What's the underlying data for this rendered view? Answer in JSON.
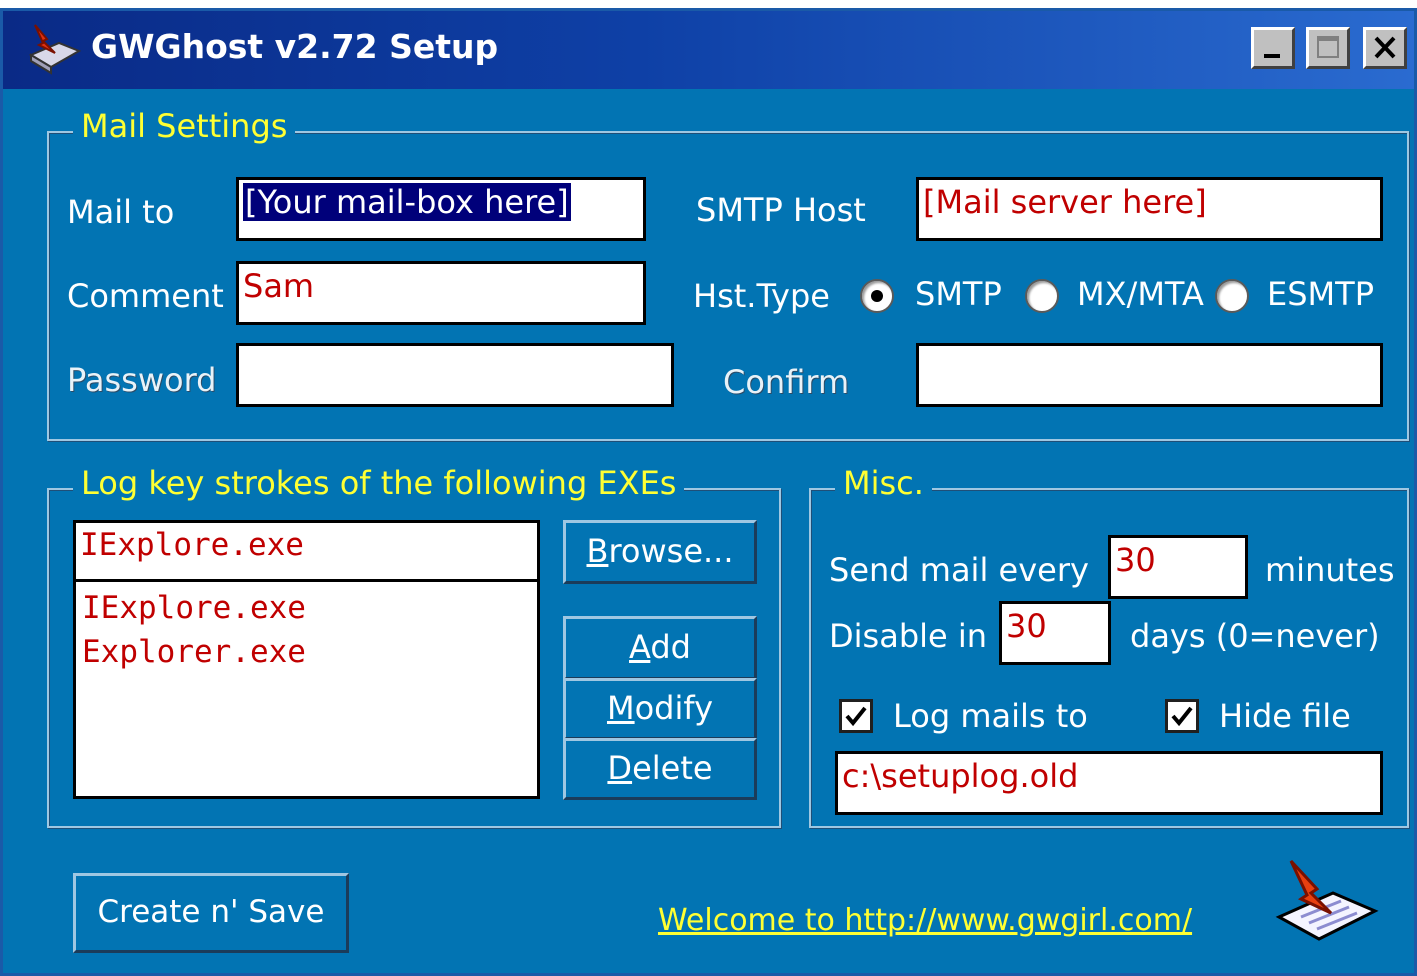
{
  "window": {
    "title": "GWGhost v2.72 Setup",
    "accent_color": "#0274b3",
    "legend_color": "#ffff33",
    "value_color": "#c00000"
  },
  "mail_settings": {
    "legend": "Mail Settings",
    "mail_to_label": "Mail to",
    "mail_to_value": "[Your mail-box here]",
    "comment_label": "Comment",
    "comment_value": "Sam",
    "password_label": "Password",
    "password_value": "",
    "smtp_host_label": "SMTP Host",
    "smtp_host_value": "[Mail server here]",
    "host_type_label": "Hst.Type",
    "host_types": [
      {
        "label": "SMTP",
        "selected": true
      },
      {
        "label": "MX/MTA",
        "selected": false
      },
      {
        "label": "ESMTP",
        "selected": false
      }
    ],
    "confirm_label": "Confirm",
    "confirm_value": ""
  },
  "log_keys": {
    "legend": "Log key strokes of the following EXEs",
    "input_value": "IExplore.exe",
    "items": [
      "IExplore.exe",
      "Explorer.exe"
    ],
    "browse": {
      "mnemonic": "B",
      "rest": "rowse..."
    },
    "add": {
      "mnemonic": "A",
      "rest": "dd"
    },
    "modify": {
      "mnemonic": "M",
      "rest": "odify"
    },
    "delete": {
      "mnemonic": "D",
      "rest": "elete"
    }
  },
  "misc": {
    "legend": "Misc.",
    "send_mail_label": "Send mail every",
    "send_mail_value": "30",
    "send_mail_unit": "minutes",
    "disable_label": "Disable in",
    "disable_value": "30",
    "disable_unit": "days (0=never)",
    "log_mails_label": "Log mails to",
    "log_mails_checked": true,
    "hide_file_label": "Hide file",
    "hide_file_checked": true,
    "log_path": "c:\\setuplog.old"
  },
  "footer": {
    "create_button": "Create n' Save",
    "welcome_link": "Welcome to http://www.gwgirl.com/",
    "icon": "send-mail-icon"
  }
}
